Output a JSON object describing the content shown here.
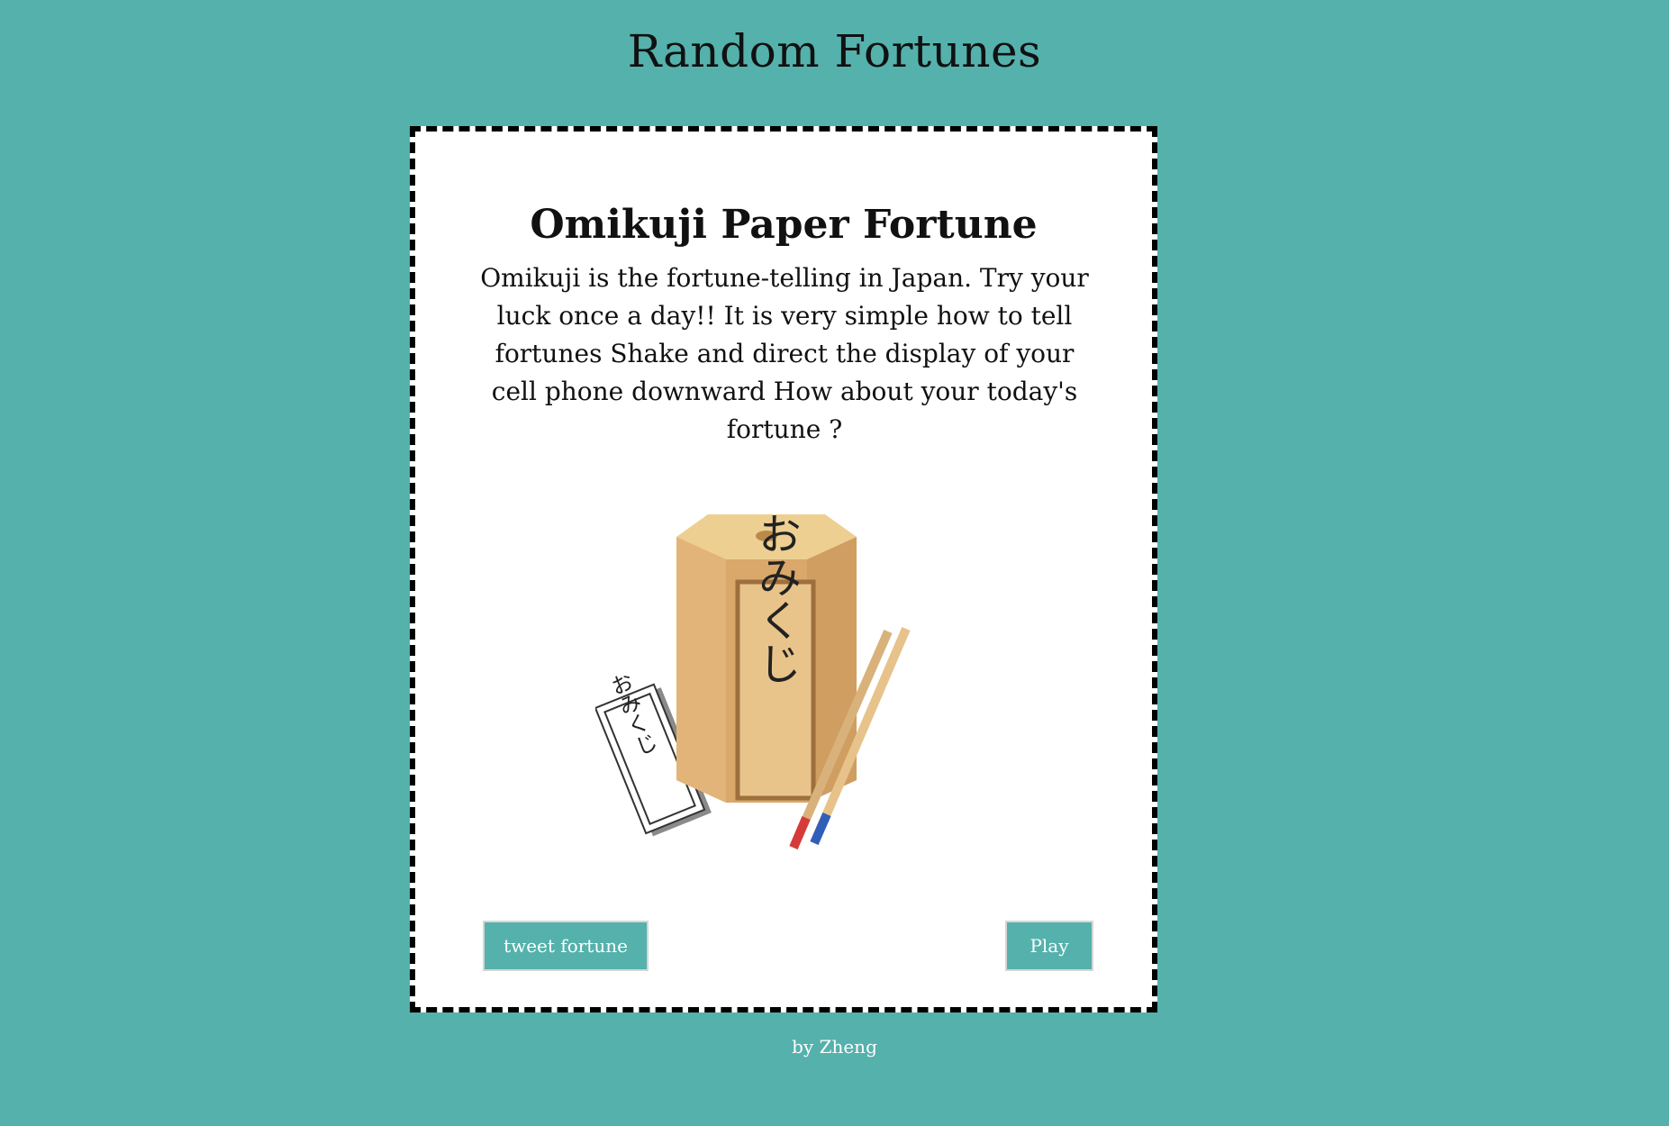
{
  "page": {
    "title": "Random Fortunes"
  },
  "card": {
    "title": "Omikuji Paper Fortune",
    "description": "Omikuji is the fortune-telling in Japan. Try your luck once a day!! It is very simple how to tell fortunes Shake and direct the display of your cell phone downward How about your today's fortune ?",
    "box_label": "おみくじ",
    "slip_label": "おみくじ"
  },
  "buttons": {
    "tweet_label": "tweet fortune",
    "play_label": "Play"
  },
  "footer": {
    "credit": "by Zheng"
  },
  "colors": {
    "background": "#55b1ac",
    "button": "#55b1ac",
    "card": "#ffffff",
    "box_wood": "#d9a86a"
  }
}
